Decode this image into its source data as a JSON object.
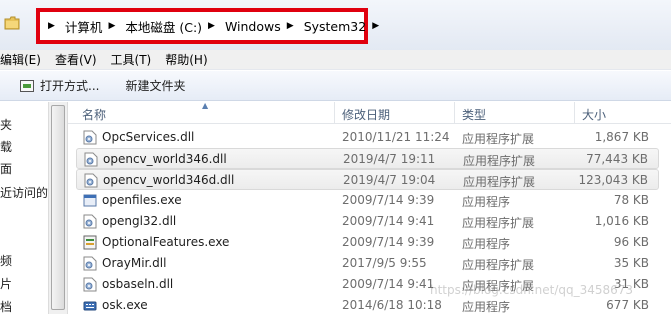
{
  "address_bar": {
    "crumbs": [
      "计算机",
      "本地磁盘 (C:)",
      "Windows",
      "System32"
    ],
    "highlight_color": "#e0000f"
  },
  "menu": [
    "编辑(E)",
    "查看(V)",
    "工具(T)",
    "帮助(H)"
  ],
  "toolbar": {
    "open_with": "打开方式...",
    "new_folder": "新建文件夹"
  },
  "nav": [
    "夹",
    "载",
    "面",
    "近访问的",
    "频",
    "片",
    "档"
  ],
  "columns": {
    "name": "名称",
    "date": "修改日期",
    "type": "类型",
    "size": "大小"
  },
  "files": [
    {
      "name": "OpcServices.dll",
      "date": "2010/11/21 11:24",
      "type": "应用程序扩展",
      "size": "1,867 KB",
      "icon": "dll-icon",
      "selected": false
    },
    {
      "name": "opencv_world346.dll",
      "date": "2019/4/7 19:11",
      "type": "应用程序扩展",
      "size": "77,443 KB",
      "icon": "dll-icon",
      "selected": true
    },
    {
      "name": "opencv_world346d.dll",
      "date": "2019/4/7 19:04",
      "type": "应用程序扩展",
      "size": "123,043 KB",
      "icon": "dll-icon",
      "selected": true
    },
    {
      "name": "openfiles.exe",
      "date": "2009/7/14 9:39",
      "type": "应用程序",
      "size": "78 KB",
      "icon": "exe-icon",
      "selected": false
    },
    {
      "name": "opengl32.dll",
      "date": "2009/7/14 9:41",
      "type": "应用程序扩展",
      "size": "1,016 KB",
      "icon": "dll-icon",
      "selected": false
    },
    {
      "name": "OptionalFeatures.exe",
      "date": "2009/7/14 9:39",
      "type": "应用程序",
      "size": "96 KB",
      "icon": "features-icon",
      "selected": false
    },
    {
      "name": "OrayMir.dll",
      "date": "2017/9/5 9:55",
      "type": "应用程序扩展",
      "size": "35 KB",
      "icon": "dll-icon",
      "selected": false
    },
    {
      "name": "osbaseln.dll",
      "date": "2009/7/14 9:41",
      "type": "应用程序扩展",
      "size": "31 KB",
      "icon": "dll-icon",
      "selected": false
    },
    {
      "name": "osk.exe",
      "date": "2014/6/18 10:18",
      "type": "应用程序",
      "size": "677 KB",
      "icon": "keyboard-icon",
      "selected": false
    }
  ],
  "watermark": "https://blog.csdn.net/qq_3458673"
}
